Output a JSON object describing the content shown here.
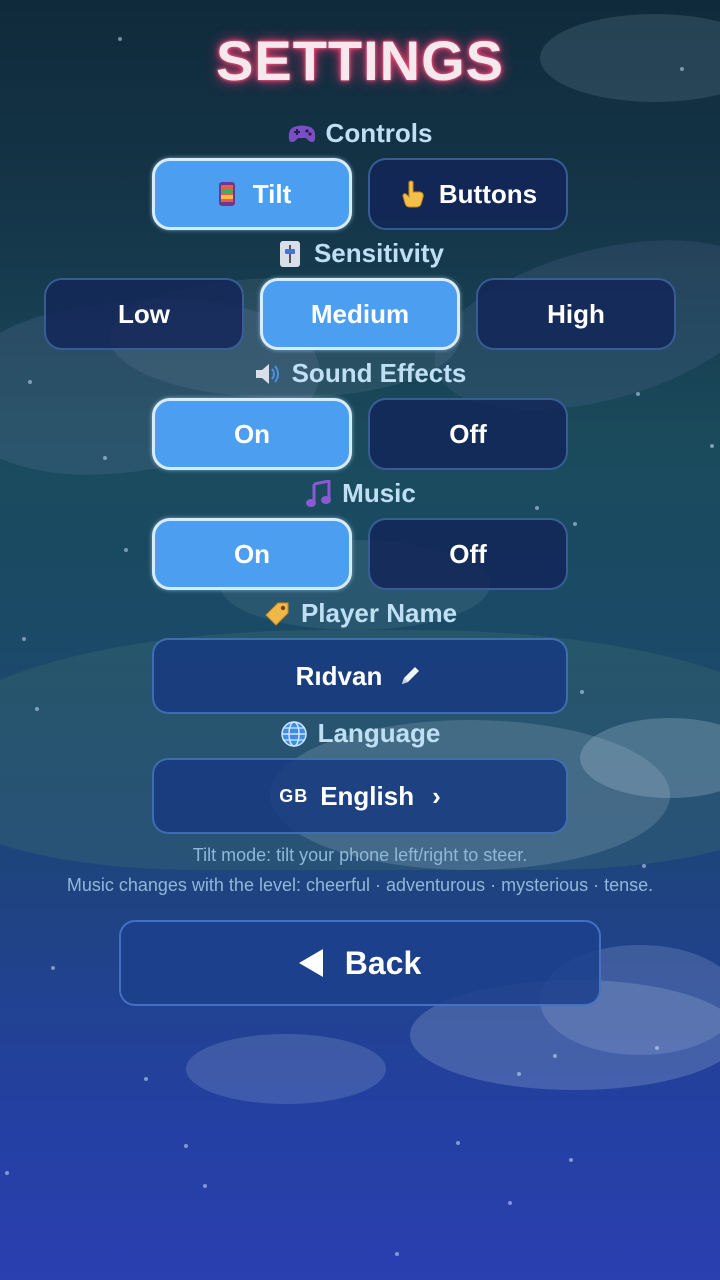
{
  "title": "SETTINGS",
  "controls": {
    "label": "Controls",
    "icon": "gamepad-icon",
    "options": [
      {
        "label": "Tilt",
        "icon": "phone-icon",
        "selected": true
      },
      {
        "label": "Buttons",
        "icon": "pointing-hand-icon",
        "selected": false
      }
    ]
  },
  "sensitivity": {
    "label": "Sensitivity",
    "icon": "sensitivity-icon",
    "options": [
      {
        "label": "Low",
        "selected": false
      },
      {
        "label": "Medium",
        "selected": true
      },
      {
        "label": "High",
        "selected": false
      }
    ]
  },
  "sound_effects": {
    "label": "Sound Effects",
    "icon": "speaker-icon",
    "options": [
      {
        "label": "On",
        "selected": true
      },
      {
        "label": "Off",
        "selected": false
      }
    ]
  },
  "music": {
    "label": "Music",
    "icon": "music-note-icon",
    "options": [
      {
        "label": "On",
        "selected": true
      },
      {
        "label": "Off",
        "selected": false
      }
    ]
  },
  "player_name": {
    "label": "Player Name",
    "icon": "tag-icon",
    "value": "Rıdvan",
    "edit_icon": "pencil-icon"
  },
  "language": {
    "label": "Language",
    "icon": "globe-icon",
    "flag": "GB",
    "value": "English",
    "chevron": "›"
  },
  "hints": {
    "line1": "Tilt mode: tilt your phone left/right to steer.",
    "line2": "Music changes with the level: cheerful · adventurous · mysterious · tense."
  },
  "back_label": "Back",
  "colors": {
    "selected": "#4b9ef0",
    "unselected": "#12245a",
    "title_glow": "#e0336a"
  }
}
